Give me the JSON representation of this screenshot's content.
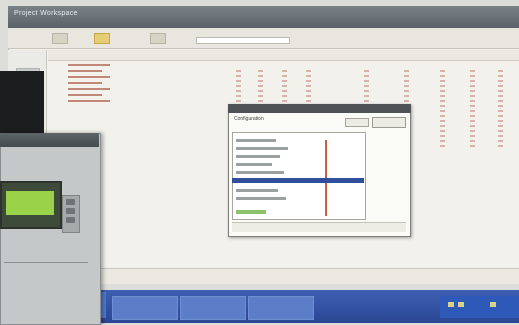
{
  "window": {
    "title": "Project Workspace"
  },
  "toolbar": {
    "buttons": [
      "open-icon",
      "save-icon",
      "folder-icon"
    ]
  },
  "dialog": {
    "title": "",
    "subtitle": "Configuration"
  },
  "overlay": {
    "device": "controller-panel"
  },
  "colors": {
    "taskbar": "#2a4694",
    "selection": "#2f4f9a",
    "accent_line": "#c9603f",
    "lcd": "#9ad24a",
    "tree_lines": "#c08878"
  }
}
